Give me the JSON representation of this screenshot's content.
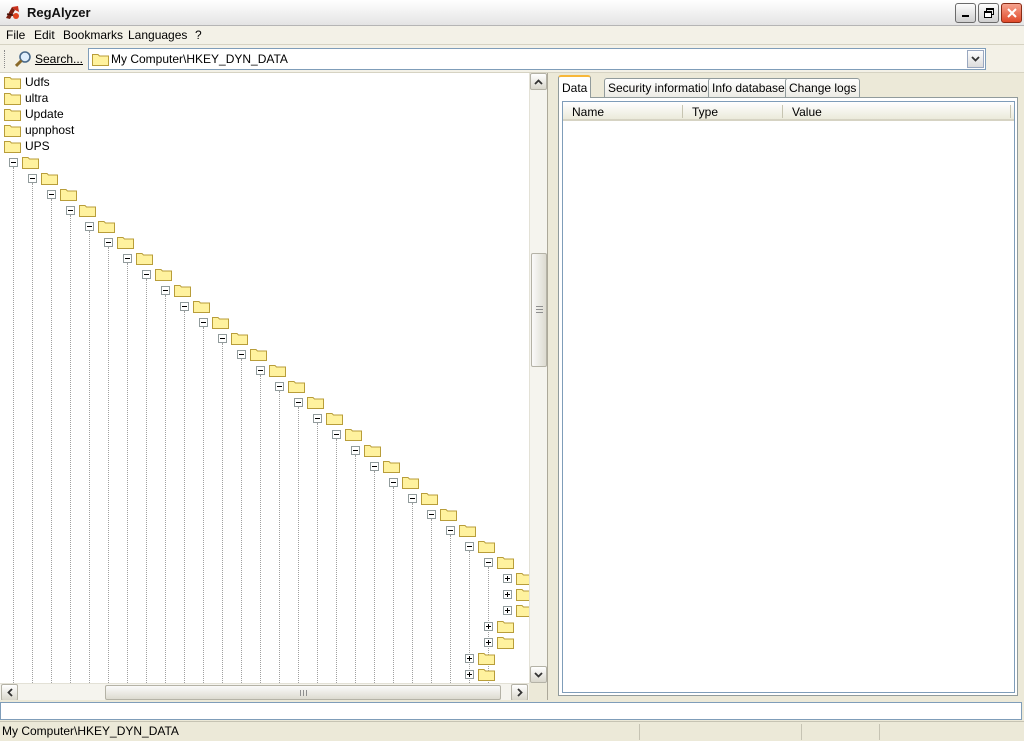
{
  "window": {
    "title": "RegAlyzer"
  },
  "menu": {
    "items": [
      "File",
      "Edit",
      "Bookmarks",
      "Languages",
      "?"
    ]
  },
  "toolbar": {
    "search_label": "Search..."
  },
  "address": {
    "path": "My Computer\\HKEY_DYN_DATA"
  },
  "tree": {
    "named_keys": [
      "Udfs",
      "ultra",
      "Update",
      "upnphost",
      "UPS"
    ],
    "nested_depth": 26,
    "siblings_at_bottom": [
      {
        "depth": 26,
        "count": 3,
        "expander": "plus"
      },
      {
        "depth": 25,
        "count": 2,
        "expander": "plus"
      },
      {
        "depth": 24,
        "count": 2,
        "expander": "plus"
      }
    ]
  },
  "tabs": [
    {
      "label": "Data",
      "active": true
    },
    {
      "label": "Security information",
      "active": false
    },
    {
      "label": "Info database",
      "active": false
    },
    {
      "label": "Change logs",
      "active": false
    }
  ],
  "list": {
    "columns": [
      "Name",
      "Type",
      "Value"
    ],
    "rows": []
  },
  "status": {
    "path": "My Computer\\HKEY_DYN_DATA"
  },
  "icons": {
    "app": "regalyzer-app-icon",
    "search": "magnifier-icon",
    "folder": "folder-icon",
    "minimize": "minimize-icon",
    "restore": "restore-icon",
    "close": "close-icon"
  },
  "colors": {
    "close_button": "#e04a2a",
    "folder_fill": "#fff29e",
    "folder_stroke": "#b89d3a",
    "active_tab_accent": "#f7b73a"
  }
}
